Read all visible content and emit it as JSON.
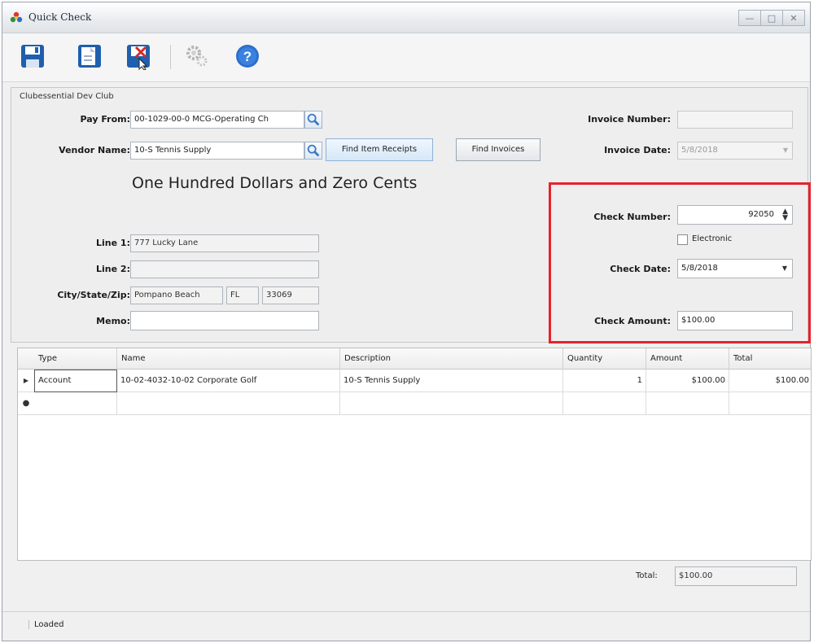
{
  "window": {
    "title": "Quick Check",
    "controls": [
      "minimize",
      "maximize",
      "close"
    ]
  },
  "toolbar": {
    "buttons": [
      "save-icon",
      "save-new-icon",
      "delete-icon",
      "settings-icon",
      "help-icon"
    ]
  },
  "club": {
    "name": "Clubessential Dev Club"
  },
  "form": {
    "pay_from_label": "Pay From:",
    "pay_from_value": "00-1029-00-0 MCG-Operating Ch",
    "vendor_name_label": "Vendor Name:",
    "vendor_name_value": "10-S Tennis Supply",
    "find_item_receipts_label": "Find Item Receipts",
    "find_invoices_label": "Find Invoices",
    "invoice_number_label": "Invoice Number:",
    "invoice_number_value": "",
    "invoice_date_label": "Invoice Date:",
    "invoice_date_value": "5/8/2018",
    "amount_in_words": "One Hundred  Dollars and Zero Cents",
    "line1_label": "Line 1:",
    "line1_value": "777 Lucky Lane",
    "line2_label": "Line 2:",
    "line2_value": "",
    "city_state_zip_label": "City/State/Zip:",
    "city_value": "Pompano Beach",
    "state_value": "FL",
    "zip_value": "33069",
    "memo_label": "Memo:",
    "memo_value": "",
    "check_number_label": "Check Number:",
    "check_number_value": "92050",
    "electronic_label": "Electronic",
    "electronic_checked": false,
    "check_date_label": "Check Date:",
    "check_date_value": "5/8/2018",
    "check_amount_label": "Check Amount:",
    "check_amount_value": "$100.00",
    "highlight_color": "#e5232d"
  },
  "grid": {
    "columns": [
      "Type",
      "Name",
      "Description",
      "Quantity",
      "Amount",
      "Total"
    ],
    "rows": [
      {
        "type": "Account",
        "name": "10-02-4032-10-02 Corporate Golf",
        "description": "10-S Tennis Supply",
        "quantity": "1",
        "amount": "$100.00",
        "total": "$100.00"
      }
    ]
  },
  "totals": {
    "label": "Total:",
    "value": "$100.00"
  },
  "status": {
    "text": "Loaded"
  }
}
